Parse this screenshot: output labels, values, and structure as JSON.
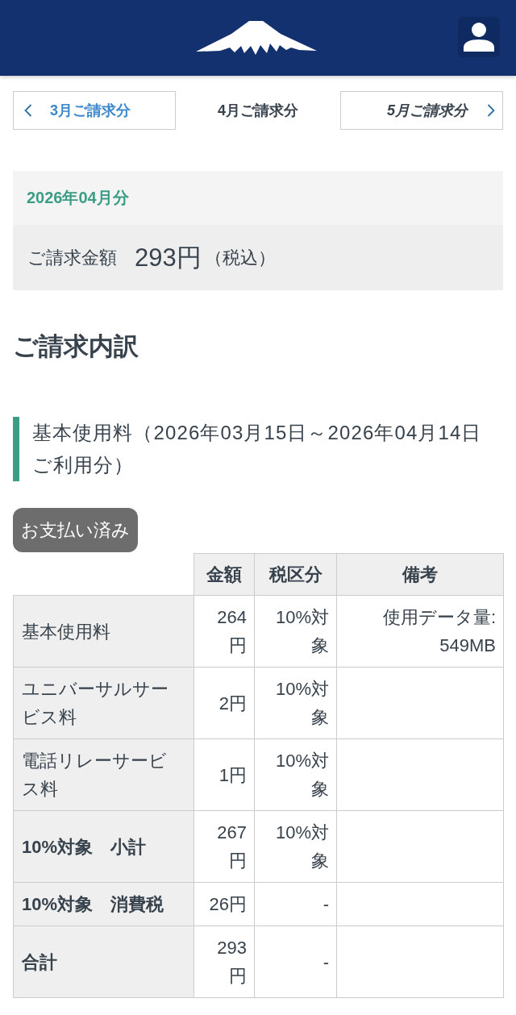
{
  "month_nav": {
    "previous": {
      "label": "3月ご請求分",
      "disabled": false
    },
    "current": "4月ご請求分",
    "next": {
      "label": "5月ご請求分",
      "disabled": true
    }
  },
  "summary": {
    "period": "2026年04月分",
    "amount_label": "ご請求金額",
    "amount": "293円",
    "tax_note": "（税込）"
  },
  "breakdown": {
    "title": "ご請求内訳",
    "sections": [
      {
        "heading": "基本使用料（2026年03月15日～2026年04月14日ご利用分）",
        "status": "お支払い済み",
        "columns": [
          "金額",
          "税区分",
          "備考"
        ],
        "rows": [
          {
            "kind": "item",
            "label": "基本使用料",
            "amount": "264円",
            "tax": "10%対象",
            "note": "使用データ量: 549MB"
          },
          {
            "kind": "item",
            "label": "ユニバーサルサービス料",
            "amount": "2円",
            "tax": "10%対象"
          },
          {
            "kind": "item",
            "label": "電話リレーサービス料",
            "amount": "1円",
            "tax": "10%対象"
          },
          {
            "kind": "subtotal",
            "label": "10%対象　小計",
            "amount": "267円",
            "tax": "10%対象"
          },
          {
            "kind": "subtotal",
            "label": "10%対象　消費税",
            "amount": "26円",
            "tax": "-"
          },
          {
            "kind": "subtotal",
            "label": "合計",
            "amount": "293円",
            "tax": "-"
          }
        ]
      }
    ]
  }
}
